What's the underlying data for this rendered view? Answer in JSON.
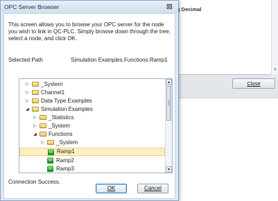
{
  "background_window": {
    "text_fragment": "g Decimal",
    "close_button": "Close"
  },
  "dialog": {
    "title": "OPC Server Browser",
    "close_glyph": "⊠",
    "description": "This screen allows you to browse your OPC server for the node you wish to link in QC-PLC. Simply browse down through the tree, select a node, and click OK.",
    "selected_path_label": "Selected Path",
    "selected_path_value": "Simulation Examples.Functions.Ramp1",
    "status": "Connection Success.",
    "ok_label": "OK",
    "cancel_label": "Cancel"
  },
  "tree": {
    "items": [
      {
        "label": "_System",
        "level": 0,
        "state": "collapsed",
        "icon": "folder-icon"
      },
      {
        "label": "Channel1",
        "level": 0,
        "state": "collapsed",
        "icon": "folder-icon"
      },
      {
        "label": "Data Type Examples",
        "level": 0,
        "state": "collapsed",
        "icon": "folder-icon"
      },
      {
        "label": "Simulation Examples",
        "level": 0,
        "state": "expanded",
        "icon": "folder-icon"
      },
      {
        "label": "_Statistics",
        "level": 1,
        "state": "collapsed",
        "icon": "folder-icon"
      },
      {
        "label": "_System",
        "level": 1,
        "state": "collapsed",
        "icon": "folder-icon"
      },
      {
        "label": "Functions",
        "level": 1,
        "state": "expanded",
        "icon": "folder-icon"
      },
      {
        "label": "_System",
        "level": 2,
        "state": "collapsed",
        "icon": "folder-icon"
      },
      {
        "label": "Ramp1",
        "level": 2,
        "state": "leaf",
        "icon": "tag-icon",
        "selected": true
      },
      {
        "label": "Ramp2",
        "level": 2,
        "state": "leaf",
        "icon": "tag-icon"
      },
      {
        "label": "Ramp3",
        "level": 2,
        "state": "leaf",
        "icon": "tag-icon"
      }
    ]
  },
  "colors": {
    "selection_fill": "#fbeec4",
    "selection_border": "#f1cd7b",
    "dialog_frame": "#dde8f5"
  }
}
